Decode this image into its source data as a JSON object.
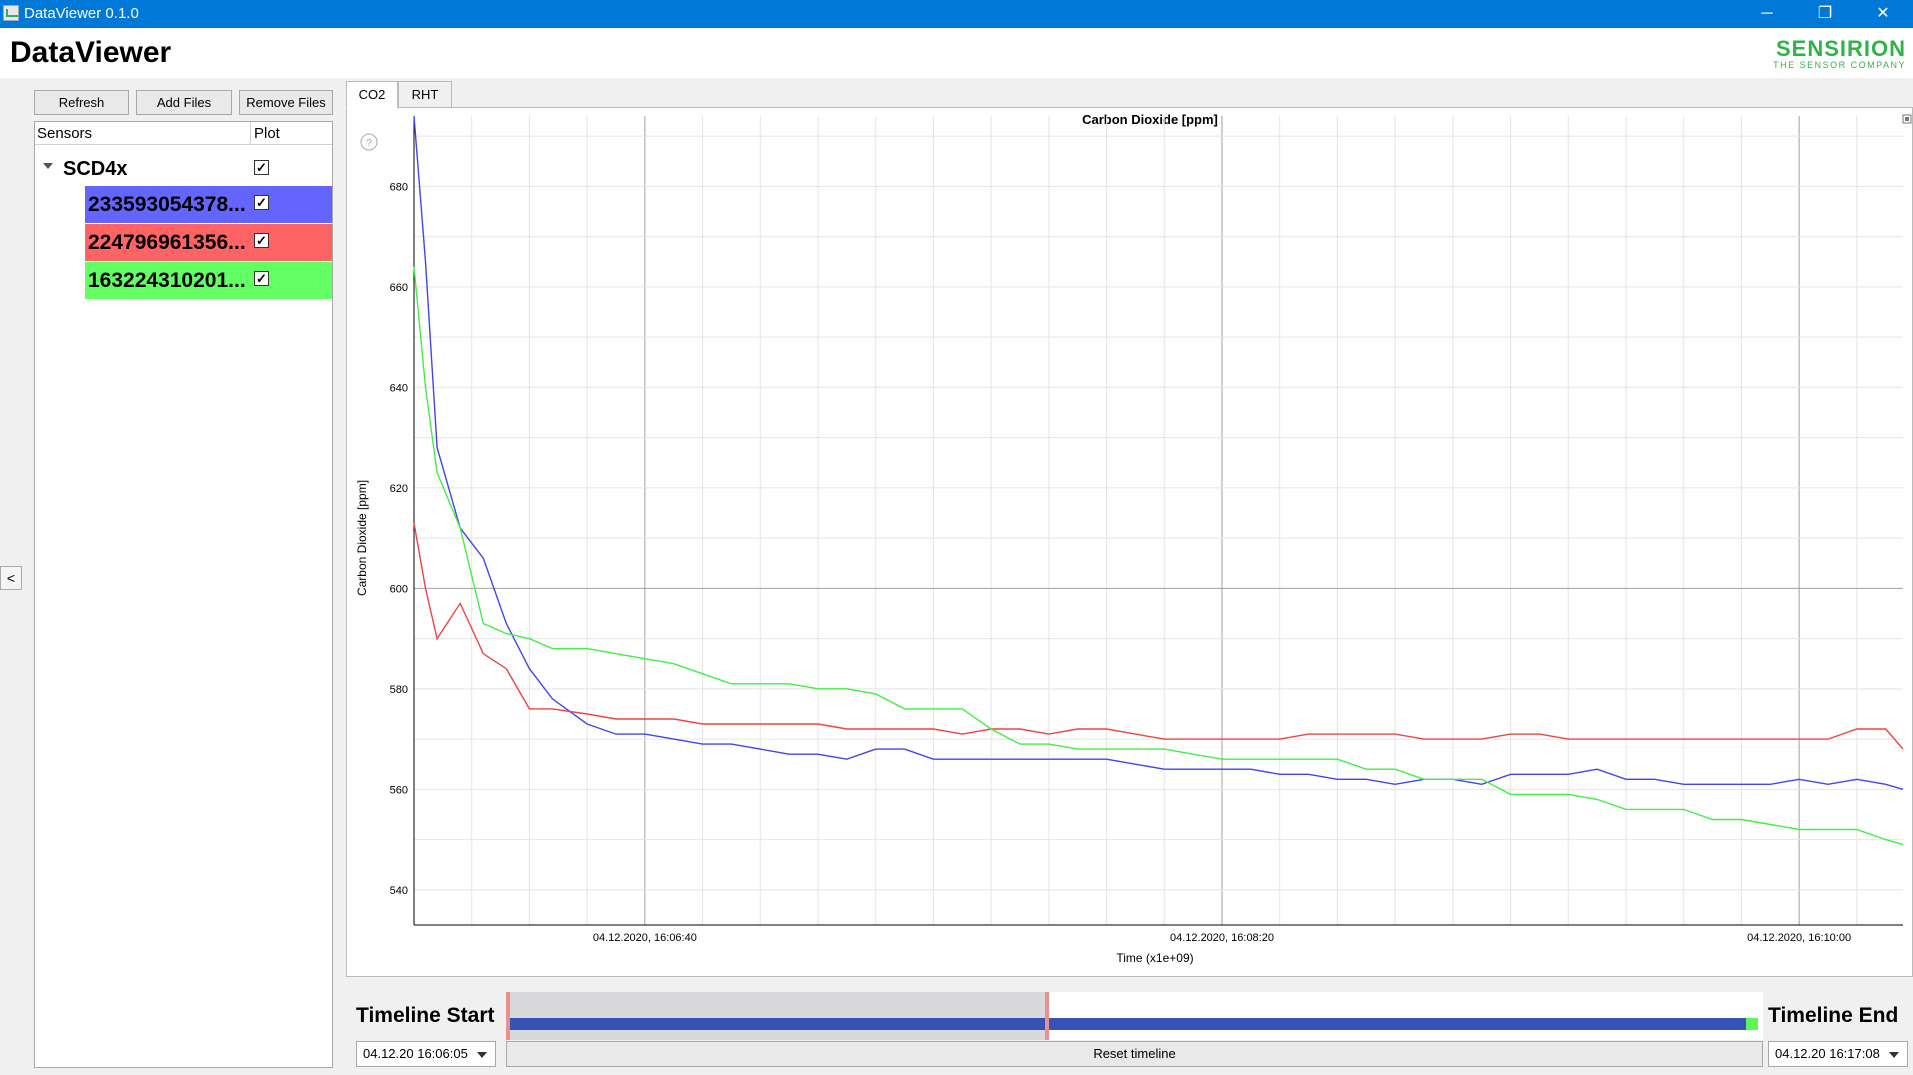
{
  "window": {
    "title": "DataViewer 0.1.0",
    "minimize": "─",
    "maximize": "❐",
    "close": "✕"
  },
  "header": {
    "app_title": "DataViewer",
    "logo_line1": "SENSIRION",
    "logo_line2": "THE SENSOR COMPANY"
  },
  "sidebar": {
    "collapse_label": "<",
    "buttons": {
      "refresh": "Refresh",
      "add_files": "Add Files",
      "remove_files": "Remove Files"
    },
    "columns": {
      "sensors": "Sensors",
      "plot": "Plot"
    },
    "group": {
      "name": "SCD4x",
      "checked": true
    },
    "sensors": [
      {
        "label": "233593054378...",
        "color": "#6464ff",
        "checked": true
      },
      {
        "label": "224796961356...",
        "color": "#ff6464",
        "checked": true
      },
      {
        "label": "163224310201...",
        "color": "#64ff64",
        "checked": true
      }
    ],
    "check_glyph": "✓"
  },
  "tabs": [
    {
      "label": "CO2",
      "active": true
    },
    {
      "label": "RHT",
      "active": false
    }
  ],
  "chart_data": {
    "type": "line",
    "title": "Carbon Dioxide [ppm]",
    "xlabel": "Time (x1e+09)",
    "ylabel": "Carbon Dioxide [ppm]",
    "ylim": [
      533,
      694
    ],
    "yticks": [
      540,
      560,
      580,
      600,
      620,
      640,
      660,
      680
    ],
    "x_tick_labels": [
      "04.12.2020, 16:06:40",
      "04.12.2020, 16:08:20",
      "04.12.2020, 16:10:00"
    ],
    "x_tick_seconds": [
      40,
      140,
      240
    ],
    "xlim_seconds": [
      0,
      258
    ],
    "grid": true,
    "series": [
      {
        "color": "#4444ee",
        "x": [
          0,
          2,
          4,
          8,
          12,
          16,
          20,
          24,
          30,
          35,
          40,
          45,
          50,
          55,
          60,
          65,
          70,
          75,
          80,
          85,
          90,
          95,
          100,
          105,
          110,
          115,
          120,
          125,
          130,
          135,
          140,
          145,
          150,
          155,
          160,
          165,
          170,
          175,
          180,
          185,
          190,
          195,
          200,
          205,
          210,
          215,
          220,
          225,
          230,
          235,
          240,
          245,
          250,
          255,
          258
        ],
        "y": [
          694,
          665,
          628,
          612,
          606,
          593,
          584,
          578,
          573,
          571,
          571,
          570,
          569,
          569,
          568,
          567,
          567,
          566,
          568,
          568,
          566,
          566,
          566,
          566,
          566,
          566,
          566,
          565,
          564,
          564,
          564,
          564,
          563,
          563,
          562,
          562,
          561,
          562,
          562,
          561,
          563,
          563,
          563,
          564,
          562,
          562,
          561,
          561,
          561,
          561,
          562,
          561,
          562,
          561,
          560
        ]
      },
      {
        "color": "#ee4444",
        "x": [
          0,
          2,
          4,
          8,
          12,
          16,
          20,
          24,
          30,
          35,
          40,
          45,
          50,
          55,
          60,
          65,
          70,
          75,
          80,
          85,
          90,
          95,
          100,
          105,
          110,
          115,
          120,
          125,
          130,
          135,
          140,
          145,
          150,
          155,
          160,
          165,
          170,
          175,
          180,
          185,
          190,
          195,
          200,
          205,
          210,
          215,
          220,
          225,
          230,
          235,
          240,
          245,
          250,
          255,
          258
        ],
        "y": [
          613,
          600,
          590,
          597,
          587,
          584,
          576,
          576,
          575,
          574,
          574,
          574,
          573,
          573,
          573,
          573,
          573,
          572,
          572,
          572,
          572,
          571,
          572,
          572,
          571,
          572,
          572,
          571,
          570,
          570,
          570,
          570,
          570,
          571,
          571,
          571,
          571,
          570,
          570,
          570,
          571,
          571,
          570,
          570,
          570,
          570,
          570,
          570,
          570,
          570,
          570,
          570,
          572,
          572,
          568
        ]
      },
      {
        "color": "#44ee44",
        "x": [
          0,
          2,
          4,
          8,
          12,
          16,
          20,
          24,
          30,
          35,
          40,
          45,
          50,
          55,
          60,
          65,
          70,
          75,
          80,
          85,
          90,
          95,
          100,
          105,
          110,
          115,
          120,
          125,
          130,
          135,
          140,
          145,
          150,
          155,
          160,
          165,
          170,
          175,
          180,
          185,
          190,
          195,
          200,
          205,
          210,
          215,
          220,
          225,
          230,
          235,
          240,
          245,
          250,
          255,
          258
        ],
        "y": [
          664,
          640,
          623,
          612,
          593,
          591,
          590,
          588,
          588,
          587,
          586,
          585,
          583,
          581,
          581,
          581,
          580,
          580,
          579,
          576,
          576,
          576,
          572,
          569,
          569,
          568,
          568,
          568,
          568,
          567,
          566,
          566,
          566,
          566,
          566,
          564,
          564,
          562,
          562,
          562,
          559,
          559,
          559,
          558,
          556,
          556,
          556,
          554,
          554,
          553,
          552,
          552,
          552,
          550,
          549
        ]
      }
    ]
  },
  "timeline": {
    "start_label": "Timeline Start",
    "end_label": "Timeline End",
    "start_value": "04.12.20 16:06:05",
    "end_value": "04.12.20 16:17:08",
    "reset_label": "Reset timeline",
    "selection_fraction": 0.43
  },
  "help_icon": "?"
}
